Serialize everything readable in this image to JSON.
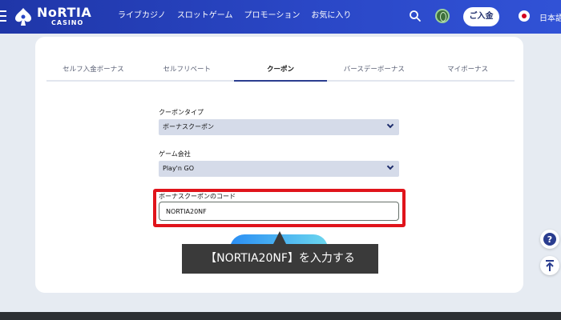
{
  "header": {
    "logo_text": "NoRTIA",
    "logo_sub": "CASINO",
    "nav": [
      "ライブカジノ",
      "スロットゲーム",
      "プロモーション",
      "お気に入り"
    ],
    "deposit_label": "ご入金",
    "language": "日本語"
  },
  "tabs": [
    "セルフ入金ボーナス",
    "セルフリベート",
    "クーポン",
    "バースデーボーナス",
    "マイボーナス"
  ],
  "active_tab": "クーポン",
  "form": {
    "coupon_type_label": "クーポンタイプ",
    "coupon_type_value": "ボーナスクーポン",
    "provider_label": "ゲーム会社",
    "provider_value": "Play'n GO",
    "code_label": "ボーナスクーポンのコード",
    "code_value": "NORTIA20NF"
  },
  "annotation": "【NORTIA20NF】を入力する",
  "colors": {
    "header_blue": "#2a47c6",
    "highlight_red": "#e0141b",
    "select_bg": "#d5dbe9",
    "tooltip_bg": "#3a3a3a"
  }
}
